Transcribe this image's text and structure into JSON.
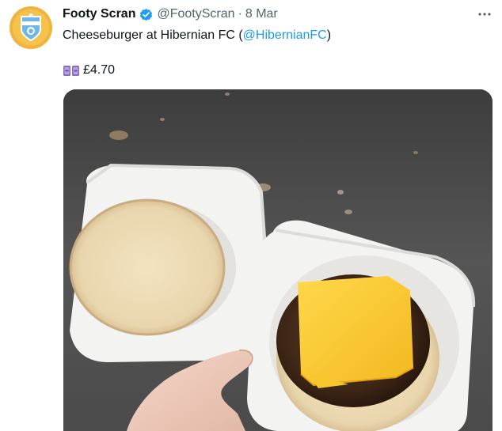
{
  "tweet": {
    "author": {
      "display_name": "Footy Scran",
      "handle": "@FootyScran",
      "verified": true,
      "avatar_icon": "footy-scran-logo-icon"
    },
    "separator": "·",
    "date": "8 Mar",
    "text_prefix": "Cheeseburger at Hibernian FC (",
    "mention": "@HibernianFC",
    "text_suffix": ")",
    "price_icon": "money-bag-icon",
    "price": "£4.70",
    "media": {
      "icon": "photo-cheeseburger-in-polystyrene-box"
    }
  },
  "colors": {
    "verified_badge": "#1d9bf0",
    "mention": "#1d9bf0",
    "secondary_text": "#536471",
    "avatar_bg": "#f2b33d"
  }
}
